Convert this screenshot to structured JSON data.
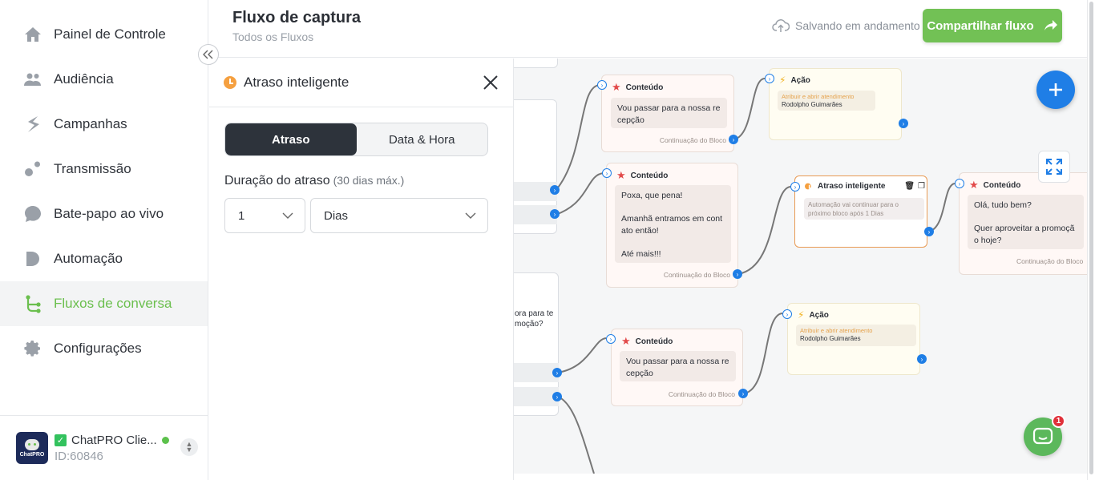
{
  "sidebar": {
    "items": [
      {
        "label": "Painel de Controle",
        "icon": "home-icon"
      },
      {
        "label": "Audiência",
        "icon": "users-icon"
      },
      {
        "label": "Campanhas",
        "icon": "campaigns-icon"
      },
      {
        "label": "Transmissão",
        "icon": "broadcast-icon"
      },
      {
        "label": "Bate-papo ao vivo",
        "icon": "chat-bubble-icon"
      },
      {
        "label": "Automação",
        "icon": "automation-icon"
      },
      {
        "label": "Fluxos de conversa",
        "icon": "flow-icon",
        "active": true
      },
      {
        "label": "Configurações",
        "icon": "gear-icon"
      }
    ],
    "account": {
      "name": "ChatPRO Clie...",
      "id": "ID:60846",
      "logo_text": "ChatPRO"
    }
  },
  "header": {
    "title": "Fluxo de captura",
    "breadcrumb": "Todos os Fluxos",
    "saving_text": "Salvando em andamento",
    "share_label": "Compartilhar fluxo"
  },
  "panel": {
    "title": "Atraso inteligente",
    "tabs": [
      "Atraso",
      "Data & Hora"
    ],
    "active_tab": "Atraso",
    "duration_label": "Duração do atraso",
    "duration_hint": "(30 dias máx.)",
    "duration_value": "1",
    "unit_value": "Dias"
  },
  "canvas": {
    "partial_text_1": "ora para te",
    "partial_text_2": "moção?",
    "nodes": {
      "c1": {
        "title": "Conteúdo",
        "text": "Vou passar para a nossa re cepção",
        "footer": "Continuação do Bloco"
      },
      "a1": {
        "title": "Ação",
        "tag": "Atribuir e abrir atendimento",
        "name": "Rodolpho Guimarães"
      },
      "c2": {
        "title": "Conteúdo",
        "text": "Poxa, que pena!\n\nAmanhã entramos em cont ato então!\n\nAté mais!!!",
        "footer": "Continuação do Bloco"
      },
      "d1": {
        "title": "Atraso inteligente",
        "text": "Automação vai continuar para o próximo bloco após 1 Dias"
      },
      "c3": {
        "title": "Conteúdo",
        "text": "Olá, tudo bem?\n\nQuer aproveitar a promoçã o hoje?",
        "footer": "Continuação do Bloco"
      },
      "c4": {
        "title": "Conteúdo",
        "text": "Vou passar para a nossa re cepção",
        "footer": "Continuação do Bloco"
      },
      "a2": {
        "title": "Ação",
        "tag": "Atribuir e abrir atendimento",
        "name": "Rodolpho Guimarães"
      }
    },
    "chat_badge": "1"
  },
  "colors": {
    "accent_green": "#72c155",
    "brand_blue": "#1f7ee6",
    "delay_orange": "#e99b55"
  }
}
